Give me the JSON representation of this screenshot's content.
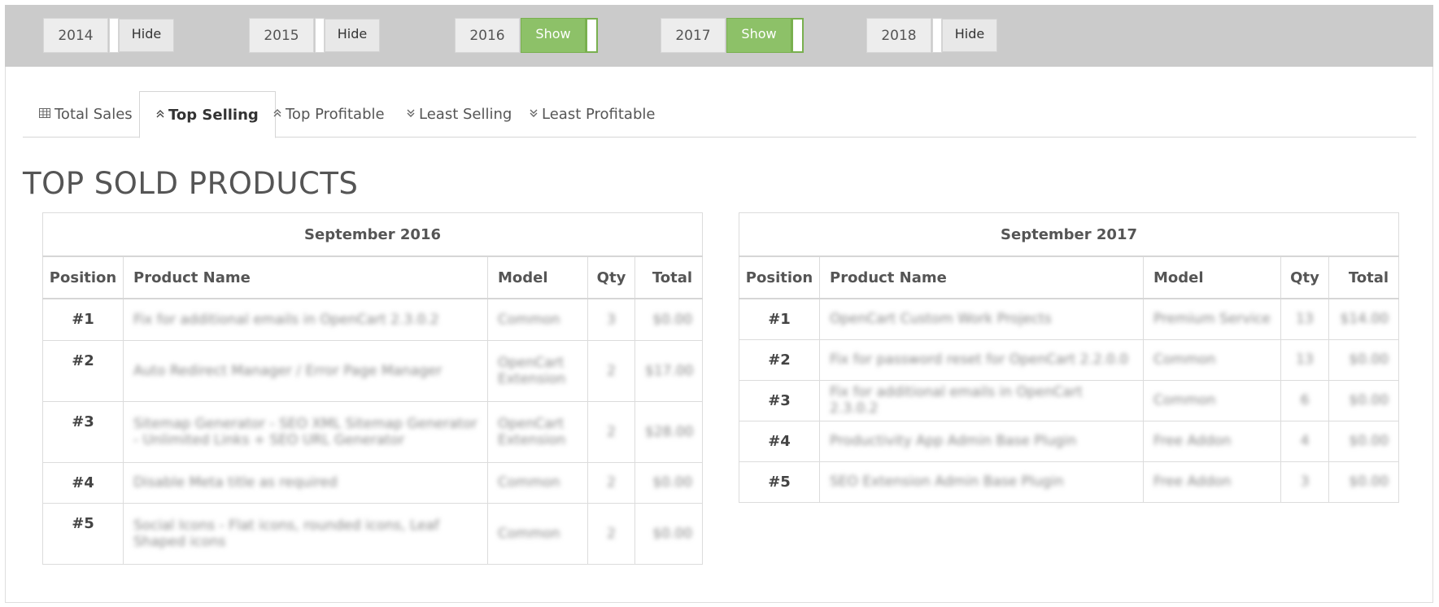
{
  "years": [
    {
      "year": "2014",
      "state": "Hide",
      "on": false
    },
    {
      "year": "2015",
      "state": "Hide",
      "on": false
    },
    {
      "year": "2016",
      "state": "Show",
      "on": true
    },
    {
      "year": "2017",
      "state": "Show",
      "on": true
    },
    {
      "year": "2018",
      "state": "Hide",
      "on": false
    }
  ],
  "tabs": [
    {
      "label": "Total Sales",
      "icon": "table-icon"
    },
    {
      "label": "Top Selling",
      "icon": "double-chevron-up-icon"
    },
    {
      "label": "Top Profitable",
      "icon": "double-chevron-up-icon"
    },
    {
      "label": "Least Selling",
      "icon": "double-chevron-down-icon"
    },
    {
      "label": "Least Profitable",
      "icon": "double-chevron-down-icon"
    }
  ],
  "active_tab": "Top Selling",
  "section_title": "TOP SOLD PRODUCTS",
  "columns": {
    "position": "Position",
    "product": "Product Name",
    "model": "Model",
    "qty": "Qty",
    "total": "Total"
  },
  "tables": [
    {
      "caption": "September 2016",
      "rows": [
        {
          "pos": "#1",
          "product": "Fix for additional emails in OpenCart 2.3.0.2",
          "model": "Common",
          "qty": "3",
          "total": "$0.00"
        },
        {
          "pos": "#2",
          "product": "Auto Redirect Manager / Error Page Manager",
          "model": "OpenCart Extension",
          "qty": "2",
          "total": "$17.00"
        },
        {
          "pos": "#3",
          "product": "Sitemap Generator - SEO XML Sitemap Generator - Unlimited Links + SEO URL Generator",
          "model": "OpenCart Extension",
          "qty": "2",
          "total": "$28.00"
        },
        {
          "pos": "#4",
          "product": "Disable Meta title as required",
          "model": "Common",
          "qty": "2",
          "total": "$0.00"
        },
        {
          "pos": "#5",
          "product": "Social Icons - Flat icons, rounded icons, Leaf Shaped icons",
          "model": "Common",
          "qty": "2",
          "total": "$0.00"
        }
      ]
    },
    {
      "caption": "September 2017",
      "rows": [
        {
          "pos": "#1",
          "product": "OpenCart Custom Work Projects",
          "model": "Premium Service",
          "qty": "13",
          "total": "$14.00"
        },
        {
          "pos": "#2",
          "product": "Fix for password reset for OpenCart 2.2.0.0",
          "model": "Common",
          "qty": "13",
          "total": "$0.00"
        },
        {
          "pos": "#3",
          "product": "Fix for additional emails in OpenCart 2.3.0.2",
          "model": "Common",
          "qty": "6",
          "total": "$0.00"
        },
        {
          "pos": "#4",
          "product": "Productivity App Admin Base Plugin",
          "model": "Free Addon",
          "qty": "4",
          "total": "$0.00"
        },
        {
          "pos": "#5",
          "product": "SEO Extension Admin Base Plugin",
          "model": "Free Addon",
          "qty": "3",
          "total": "$0.00"
        }
      ]
    }
  ]
}
